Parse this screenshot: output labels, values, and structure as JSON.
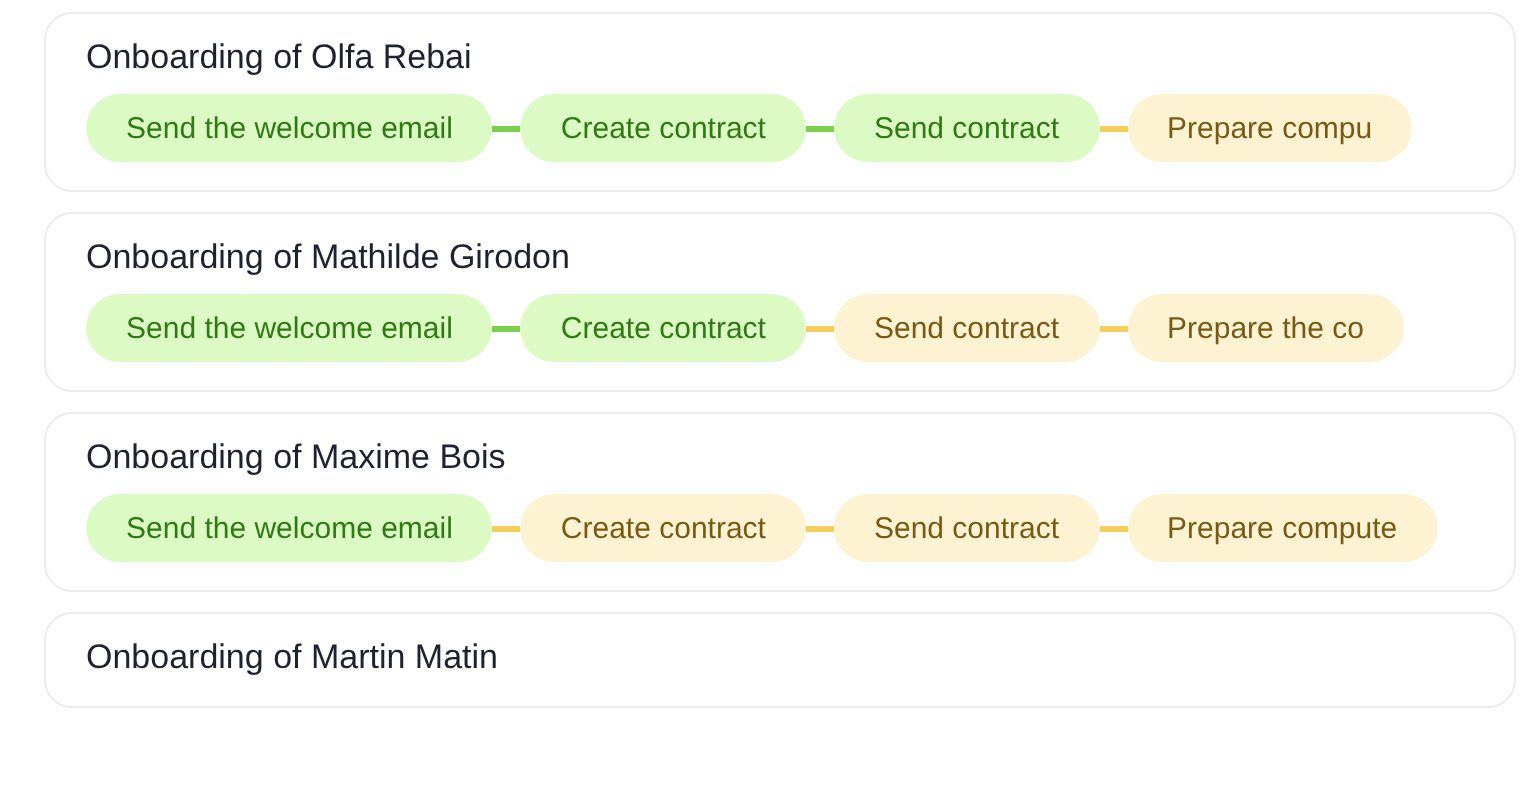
{
  "onboardings": [
    {
      "title": "Onboarding of Olfa Rebai",
      "steps": [
        {
          "label": "Send the welcome email",
          "done": true
        },
        {
          "label": "Create contract",
          "done": true
        },
        {
          "label": "Send contract",
          "done": true
        },
        {
          "label": "Prepare compu",
          "done": false
        }
      ]
    },
    {
      "title": "Onboarding of Mathilde Girodon",
      "steps": [
        {
          "label": "Send the welcome email",
          "done": true
        },
        {
          "label": "Create contract",
          "done": true
        },
        {
          "label": "Send contract",
          "done": false
        },
        {
          "label": "Prepare the co",
          "done": false
        }
      ]
    },
    {
      "title": "Onboarding of Maxime Bois",
      "steps": [
        {
          "label": "Send the welcome email",
          "done": true
        },
        {
          "label": "Create contract",
          "done": false
        },
        {
          "label": "Send contract",
          "done": false
        },
        {
          "label": "Prepare compute",
          "done": false
        }
      ]
    },
    {
      "title": "Onboarding of Martin Matin"
    }
  ]
}
